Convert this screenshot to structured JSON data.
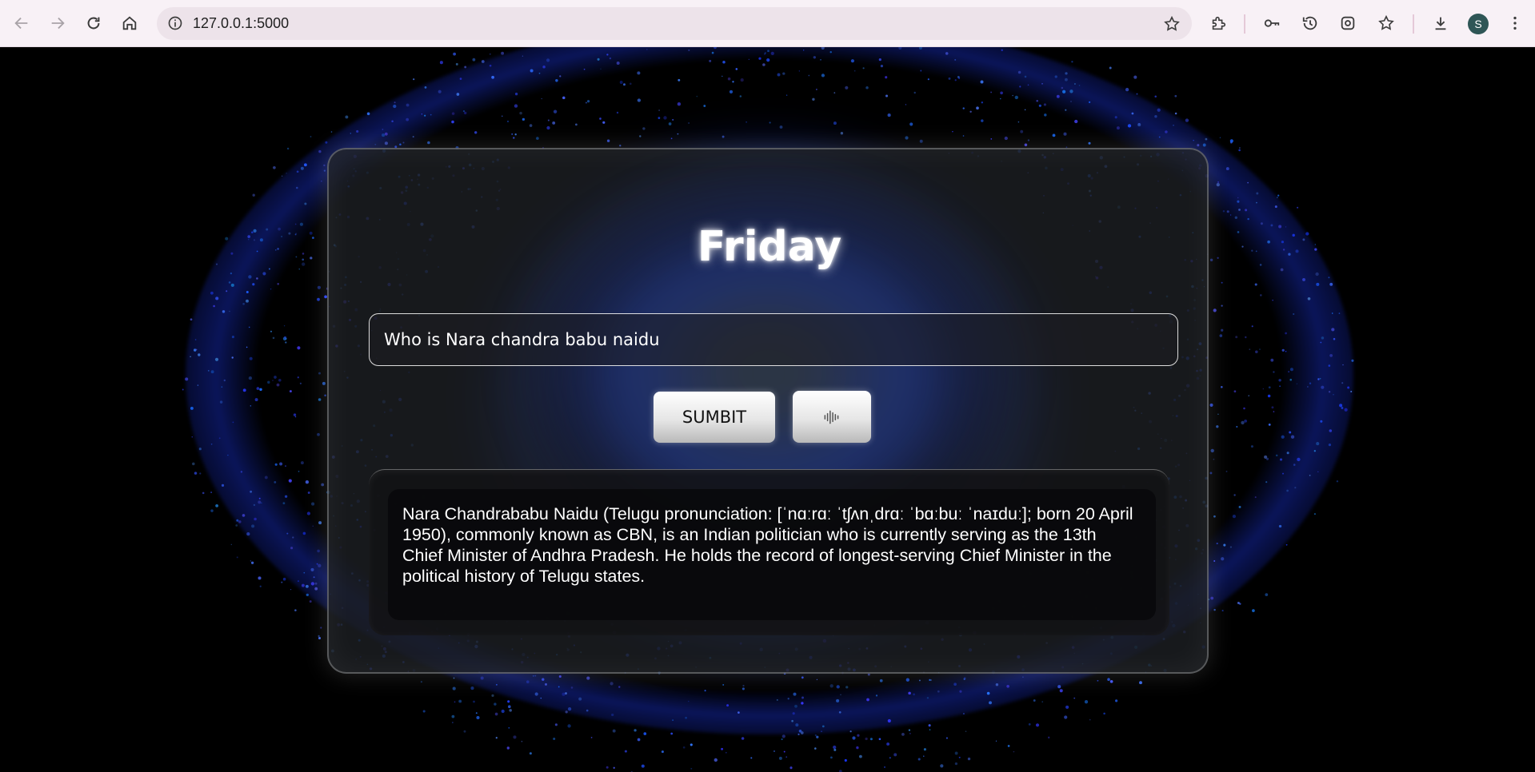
{
  "browser": {
    "url": "127.0.0.1:5000",
    "profile_initial": "S",
    "icons": {
      "back": "arrow-left-icon",
      "forward": "arrow-right-icon",
      "reload": "reload-icon",
      "home": "home-icon",
      "site_info": "info-icon",
      "bookmark": "star-icon",
      "extensions": "puzzle-icon",
      "passwords": "key-icon",
      "history": "history-icon",
      "lens": "lens-icon",
      "bookmarks": "bookmarks-star-icon",
      "downloads": "download-icon",
      "menu": "kebab-menu-icon"
    }
  },
  "app": {
    "title": "Friday",
    "query_value": "Who is Nara chandra babu naidu",
    "submit_label": "SUMBIT",
    "voice_icon": "sound-wave-icon",
    "answer": "Nara Chandrababu Naidu (Telugu pronunciation: [ˈnɑːrɑː ˈtʃʌnˌdrɑː ˈbɑːbuː ˈnaɪduː]; born 20 April 1950), commonly known as CBN, is an Indian politician who is currently serving as the 13th Chief Minister of Andhra Pradesh. He holds the record of longest-serving Chief Minister in the political history of Telugu states."
  },
  "colors": {
    "chrome_bg": "#f8f1f6",
    "omnibox_bg": "#ede3ea",
    "accent_blue": "#2850ff",
    "page_bg": "#000000",
    "avatar_bg": "#2f5656"
  }
}
